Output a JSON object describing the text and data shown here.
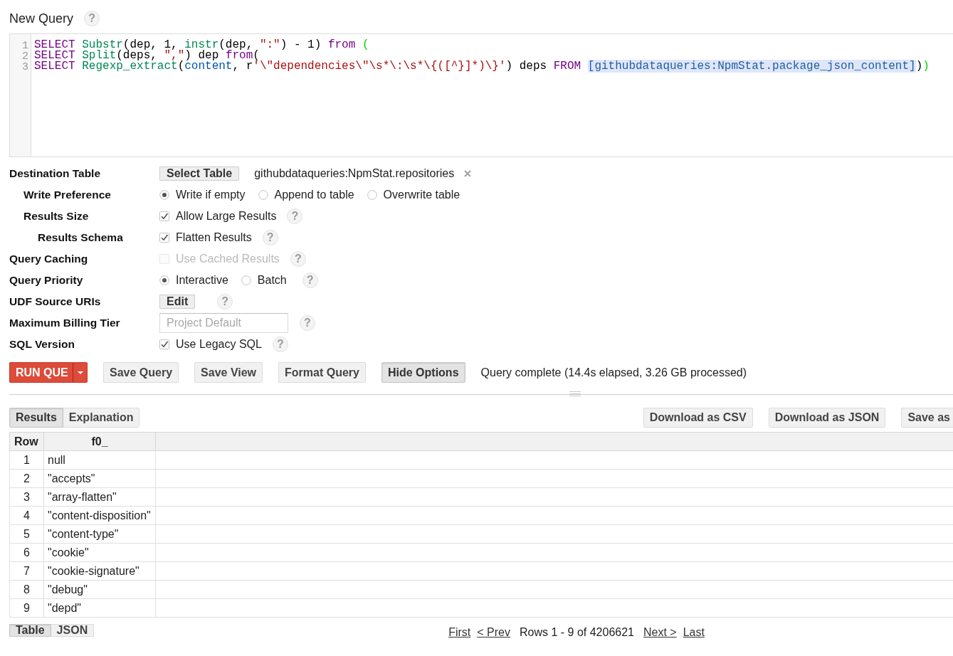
{
  "page": {
    "title": "New Query",
    "help": "?"
  },
  "editor": {
    "lines": [
      {
        "number": "1",
        "tokens": [
          {
            "kind": "keyword",
            "text": "SELECT "
          },
          {
            "kind": "function",
            "text": "Substr"
          },
          {
            "kind": "plain",
            "text": "(dep, 1, "
          },
          {
            "kind": "function",
            "text": "instr"
          },
          {
            "kind": "plain",
            "text": "(dep, "
          },
          {
            "kind": "string",
            "text": "\":\""
          },
          {
            "kind": "plain",
            "text": ") - 1) "
          },
          {
            "kind": "keyword",
            "text": "from "
          },
          {
            "kind": "bracket",
            "text": "("
          }
        ]
      },
      {
        "number": "2",
        "tokens": [
          {
            "kind": "keyword",
            "text": "SELECT "
          },
          {
            "kind": "function",
            "text": "Split"
          },
          {
            "kind": "plain",
            "text": "(deps, "
          },
          {
            "kind": "string",
            "text": "\",\""
          },
          {
            "kind": "plain",
            "text": ") dep "
          },
          {
            "kind": "keyword",
            "text": "from"
          },
          {
            "kind": "plain",
            "text": "("
          }
        ]
      },
      {
        "number": "3",
        "tokens": [
          {
            "kind": "keyword",
            "text": "SELECT "
          },
          {
            "kind": "function",
            "text": "Regexp_extract"
          },
          {
            "kind": "plain",
            "text": "("
          },
          {
            "kind": "variable",
            "text": "content"
          },
          {
            "kind": "plain",
            "text": ", r"
          },
          {
            "kind": "string",
            "text": "'\\\"dependencies\\\"\\s*\\:\\s*\\{([^}]*)\\}'"
          },
          {
            "kind": "plain",
            "text": ") deps "
          },
          {
            "kind": "keyword",
            "text": "FROM "
          },
          {
            "kind": "table",
            "text": "[githubdataqueries:NpmStat.package_json_content]"
          },
          {
            "kind": "plain",
            "text": ")"
          },
          {
            "kind": "bracket",
            "text": ")"
          }
        ]
      }
    ]
  },
  "options": [
    {
      "label": "Destination Table",
      "kind": "table",
      "button": "Select Table",
      "value": "githubdataqueries:NpmStat.repositories",
      "children": [
        {
          "label": "Write Preference",
          "kind": "radio",
          "choices": [
            {
              "label": "Write if empty",
              "selected": true
            },
            {
              "label": "Append to table",
              "selected": false
            },
            {
              "label": "Overwrite table",
              "selected": false
            }
          ]
        },
        {
          "label": "Results Size",
          "kind": "checkbox",
          "check": {
            "label": "Allow Large Results",
            "checked": true,
            "disabled": false
          },
          "help": "?",
          "children": [
            {
              "label": "Results Schema",
              "kind": "checkbox",
              "check": {
                "label": "Flatten Results",
                "checked": true,
                "disabled": false
              },
              "help": "?"
            }
          ]
        }
      ]
    },
    {
      "label": "Query Caching",
      "kind": "checkbox",
      "check": {
        "label": "Use Cached Results",
        "checked": false,
        "disabled": true
      },
      "help": "?"
    },
    {
      "label": "Query Priority",
      "kind": "radio",
      "choices": [
        {
          "label": "Interactive",
          "selected": true
        },
        {
          "label": "Batch",
          "selected": false
        }
      ],
      "help": "?"
    },
    {
      "label": "UDF Source URIs",
      "kind": "button",
      "button": "Edit",
      "help": "?"
    },
    {
      "label": "Maximum Billing Tier",
      "kind": "input",
      "placeholder": "Project Default",
      "help": "?"
    },
    {
      "label": "SQL Version",
      "kind": "checkbox",
      "check": {
        "label": "Use Legacy SQL",
        "checked": true,
        "disabled": false
      },
      "help": "?"
    }
  ],
  "toolbar": {
    "run": {
      "label": "RUN QUE"
    },
    "buttons": [
      {
        "label": "Save Query",
        "pressed": false
      },
      {
        "label": "Save View",
        "pressed": false
      },
      {
        "label": "Format Query",
        "pressed": false
      },
      {
        "label": "Hide Options",
        "pressed": true
      }
    ],
    "status": "Query complete (14.4s elapsed, 3.26 GB processed)"
  },
  "results": {
    "tabs": [
      {
        "label": "Results",
        "selected": true
      },
      {
        "label": "Explanation",
        "selected": false
      }
    ],
    "actions": [
      "Download as CSV",
      "Download as JSON",
      "Save as"
    ],
    "table": {
      "columns": [
        "Row",
        "f0_"
      ],
      "rows": [
        [
          "1",
          "null"
        ],
        [
          "2",
          "\"accepts\""
        ],
        [
          "3",
          "\"array-flatten\""
        ],
        [
          "4",
          "\"content-disposition\""
        ],
        [
          "5",
          "\"content-type\""
        ],
        [
          "6",
          "\"cookie\""
        ],
        [
          "7",
          "\"cookie-signature\""
        ],
        [
          "8",
          "\"debug\""
        ],
        [
          "9",
          "\"depd\""
        ]
      ]
    }
  },
  "footer": {
    "views": [
      {
        "label": "Table",
        "selected": true
      },
      {
        "label": "JSON",
        "selected": false
      }
    ],
    "pager": [
      {
        "kind": "link",
        "text": "First"
      },
      {
        "kind": "link",
        "text": "< Prev"
      },
      {
        "kind": "text",
        "text": "Rows 1 - 9 of 4206621"
      },
      {
        "kind": "link",
        "text": "Next >"
      },
      {
        "kind": "link",
        "text": "Last"
      }
    ]
  }
}
